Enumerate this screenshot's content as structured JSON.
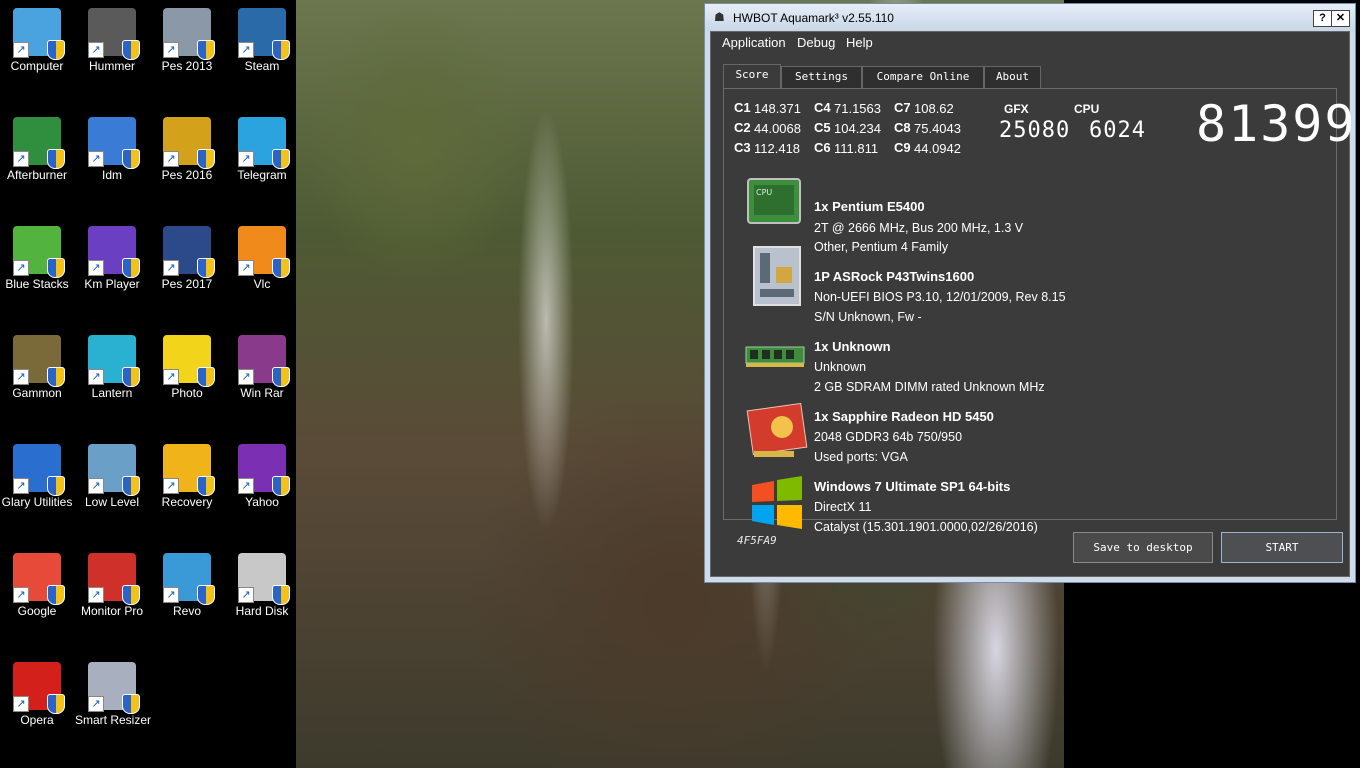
{
  "desktop": {
    "icons": [
      {
        "label": "Computer",
        "icon": "computer-icon"
      },
      {
        "label": "Hummer",
        "icon": "hummer-icon"
      },
      {
        "label": "Pes 2013",
        "icon": "pes-2013-icon"
      },
      {
        "label": "Steam",
        "icon": "steam-icon"
      },
      {
        "label": "Afterburner",
        "icon": "afterburner-icon"
      },
      {
        "label": "Idm",
        "icon": "idm-icon"
      },
      {
        "label": "Pes 2016",
        "icon": "pes-2016-icon"
      },
      {
        "label": "Telegram",
        "icon": "telegram-icon"
      },
      {
        "label": "Blue Stacks",
        "icon": "bluestacks-icon"
      },
      {
        "label": "Km Player",
        "icon": "kmplayer-icon"
      },
      {
        "label": "Pes 2017",
        "icon": "pes-2017-icon"
      },
      {
        "label": "Vlc",
        "icon": "vlc-icon"
      },
      {
        "label": "Gammon",
        "icon": "gammon-icon"
      },
      {
        "label": "Lantern",
        "icon": "lantern-icon"
      },
      {
        "label": "Photo",
        "icon": "photo-icon"
      },
      {
        "label": "Win Rar",
        "icon": "winrar-icon"
      },
      {
        "label": "Glary Utilities",
        "icon": "glary-utilities-icon"
      },
      {
        "label": "Low Level",
        "icon": "low-level-icon"
      },
      {
        "label": "Recovery",
        "icon": "recovery-icon"
      },
      {
        "label": "Yahoo",
        "icon": "yahoo-icon"
      },
      {
        "label": "Google",
        "icon": "chrome-icon"
      },
      {
        "label": "Monitor Pro",
        "icon": "monitor-pro-icon"
      },
      {
        "label": "Revo",
        "icon": "revo-icon"
      },
      {
        "label": "Hard Disk",
        "icon": "hard-disk-icon"
      },
      {
        "label": "Opera",
        "icon": "opera-icon"
      },
      {
        "label": "Smart Resizer",
        "icon": "smart-resizer-icon"
      }
    ]
  },
  "window": {
    "title": "HWBOT Aquamark³ v2.55.110",
    "help_btn": "?",
    "close_btn": "✕"
  },
  "menu": {
    "application": "Application",
    "debug": "Debug",
    "help": "Help"
  },
  "tabs": {
    "score": "Score",
    "settings": "Settings",
    "compare": "Compare Online",
    "about": "About"
  },
  "scores": {
    "c1_key": "C1",
    "c1": "148.371",
    "c2_key": "C2",
    "c2": "44.0068",
    "c3_key": "C3",
    "c3": "112.418",
    "c4_key": "C4",
    "c4": "71.1563",
    "c5_key": "C5",
    "c5": "104.234",
    "c6_key": "C6",
    "c6": "111.811",
    "c7_key": "C7",
    "c7": "108.62",
    "c8_key": "C8",
    "c8": "75.4043",
    "c9_key": "C9",
    "c9": "44.0942",
    "gfx_label": "GFX",
    "gfx": "25080",
    "cpu_label": "CPU",
    "cpu": "6024",
    "total": "81399"
  },
  "hardware": {
    "cpu_title": "1x Pentium     E5400",
    "cpu_line1": "2T @ 2666 MHz, Bus 200 MHz, 1.3 V",
    "cpu_line2": "Other, Pentium 4 Family",
    "cpu_chip_text": "CPU",
    "mb_title": "1P ASRock P43Twins1600",
    "mb_line1": "Non-UEFI BIOS P3.10, 12/01/2009, Rev 8.15",
    "mb_line2": "S/N Unknown, Fw -",
    "ram_title": "1x Unknown",
    "ram_line1": " Unknown",
    "ram_line2": "2 GB SDRAM DIMM rated Unknown MHz",
    "gpu_title": "1x Sapphire Radeon HD 5450",
    "gpu_line1": "2048 GDDR3 64b 750/950",
    "gpu_line2": "Used ports: VGA",
    "os_title": "Windows 7 Ultimate SP1 64-bits",
    "os_line1": "DirectX 11",
    "os_line2": "Catalyst (15.301.1901.0000,02/26/2016)"
  },
  "footer": {
    "hash": "4F5FA9",
    "save_label": "Save to desktop",
    "start_label": "START"
  }
}
